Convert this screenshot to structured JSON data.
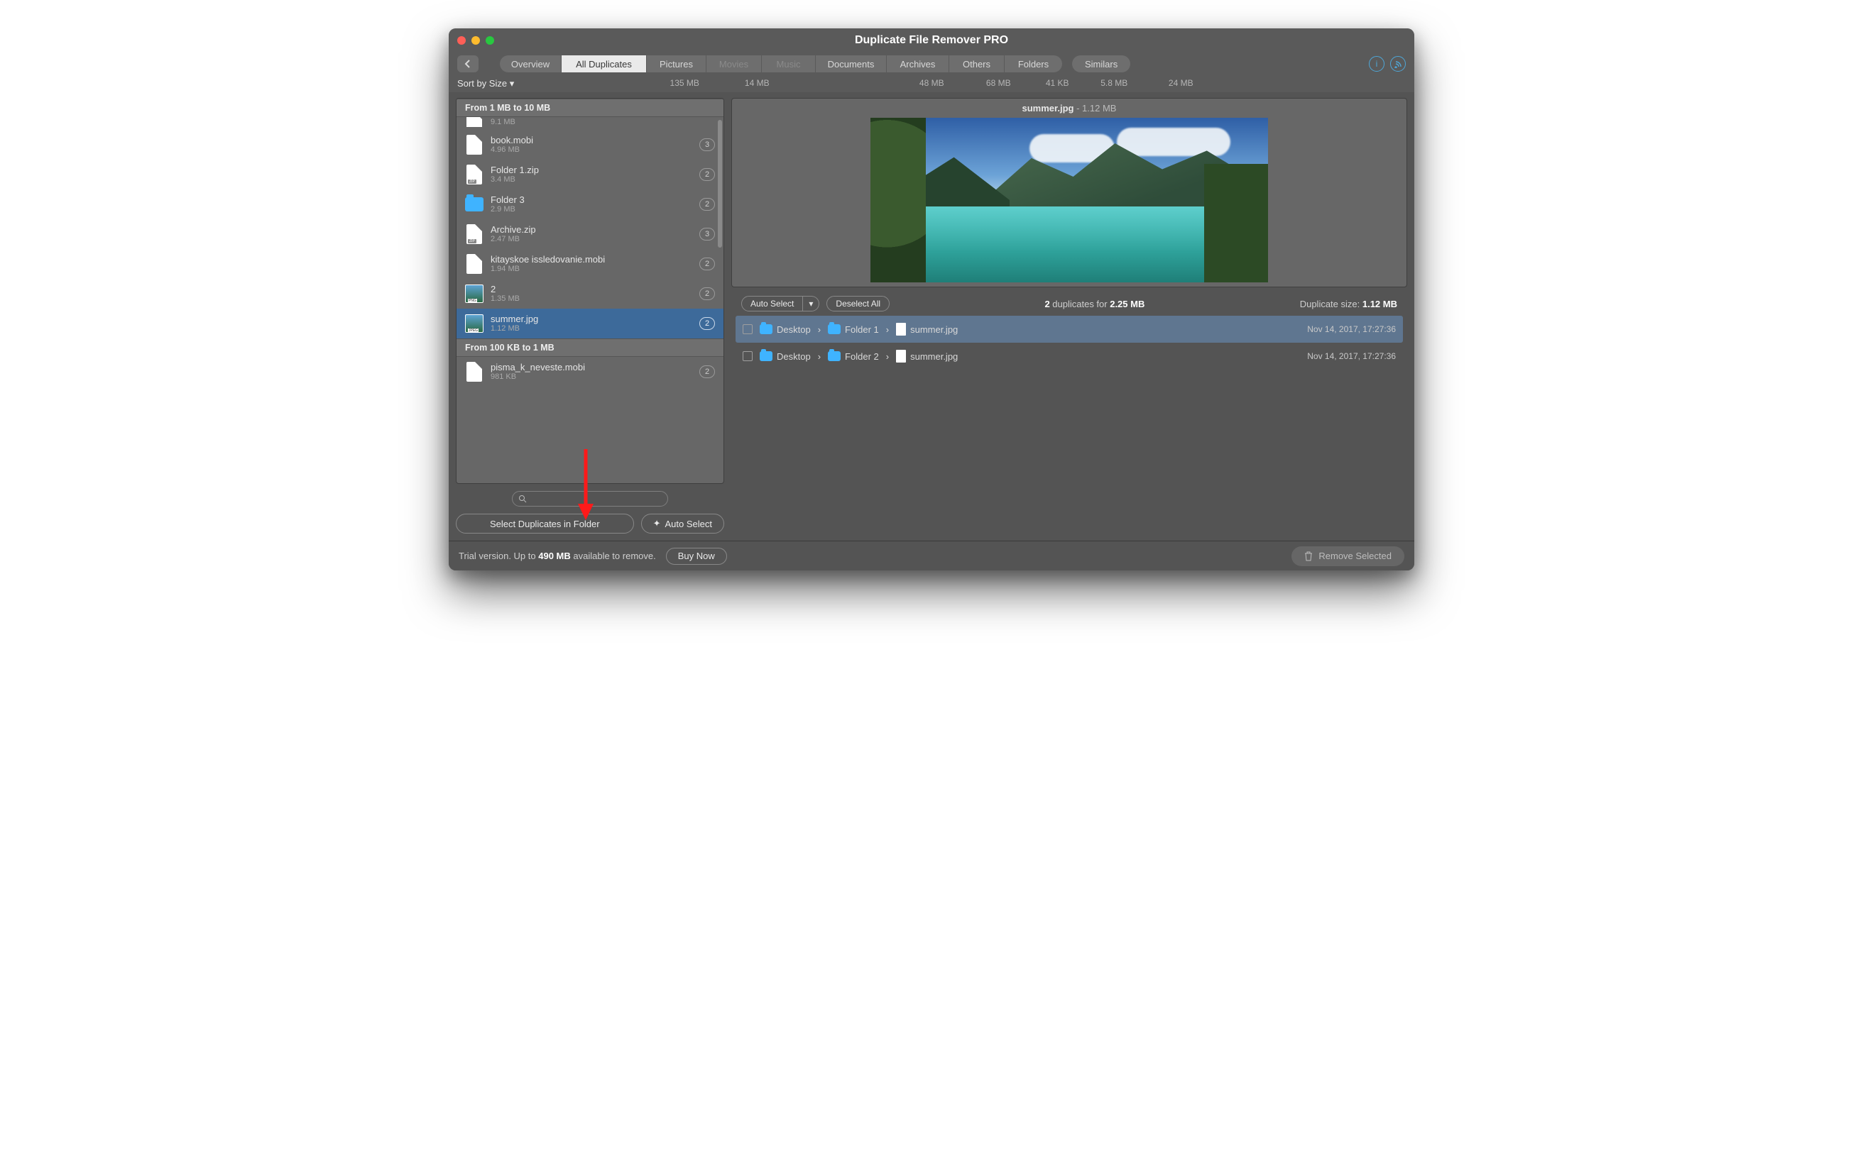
{
  "window": {
    "title": "Duplicate File Remover PRO"
  },
  "tabs": {
    "items": [
      "Overview",
      "All Duplicates",
      "Pictures",
      "Movies",
      "Music",
      "Documents",
      "Archives",
      "Others",
      "Folders"
    ],
    "similars": "Similars",
    "active_index": 1,
    "dim_indices": [
      3,
      4
    ],
    "sizes": [
      "",
      "135 MB",
      "14 MB",
      "",
      "",
      "48 MB",
      "68 MB",
      "41 KB",
      "5.8 MB"
    ],
    "similars_size": "24 MB"
  },
  "sort": {
    "label": "Sort by Size"
  },
  "groups": [
    {
      "header": "From 1 MB to 10 MB",
      "partial_top": {
        "icon": "pdf",
        "size": "9.1 MB"
      },
      "rows": [
        {
          "icon": "doc",
          "name": "book.mobi",
          "size": "4.96 MB",
          "count": "3"
        },
        {
          "icon": "zip",
          "name": "Folder 1.zip",
          "size": "3.4 MB",
          "count": "2"
        },
        {
          "icon": "folder",
          "name": "Folder 3",
          "size": "2.9 MB",
          "count": "2"
        },
        {
          "icon": "zip",
          "name": "Archive.zip",
          "size": "2.47 MB",
          "count": "3"
        },
        {
          "icon": "doc",
          "name": "kitayskoe issledovanie.mobi",
          "size": "1.94 MB",
          "count": "2"
        },
        {
          "icon": "png",
          "name": "2",
          "size": "1.35 MB",
          "count": "2"
        },
        {
          "icon": "jpeg",
          "name": "summer.jpg",
          "size": "1.12 MB",
          "count": "2",
          "selected": true
        }
      ]
    },
    {
      "header": "From 100 KB to 1 MB",
      "rows": [
        {
          "icon": "doc",
          "name": "pisma_k_neveste.mobi",
          "size": "981 KB",
          "count": "2"
        }
      ]
    }
  ],
  "left_buttons": {
    "select_folder": "Select Duplicates in Folder",
    "auto_select": "Auto Select"
  },
  "preview": {
    "filename": "summer.jpg",
    "size": "1.12 MB"
  },
  "midbar": {
    "auto_select": "Auto Select",
    "deselect_all": "Deselect All",
    "summary_count": "2",
    "summary_prefix": " duplicates for ",
    "summary_size": "2.25 MB",
    "dup_size_label": "Duplicate size: ",
    "dup_size_value": "1.12 MB"
  },
  "duplicates": [
    {
      "path": [
        "Desktop",
        "Folder 1",
        "summer.jpg"
      ],
      "timestamp": "Nov 14, 2017, 17:27:36",
      "selected": true
    },
    {
      "path": [
        "Desktop",
        "Folder 2",
        "summer.jpg"
      ],
      "timestamp": "Nov 14, 2017, 17:27:36",
      "selected": false
    }
  ],
  "footer": {
    "trial_prefix": "Trial version. Up to ",
    "trial_size": "490 MB",
    "trial_suffix": " available to remove.",
    "buy_now": "Buy Now",
    "remove_selected": "Remove Selected"
  }
}
